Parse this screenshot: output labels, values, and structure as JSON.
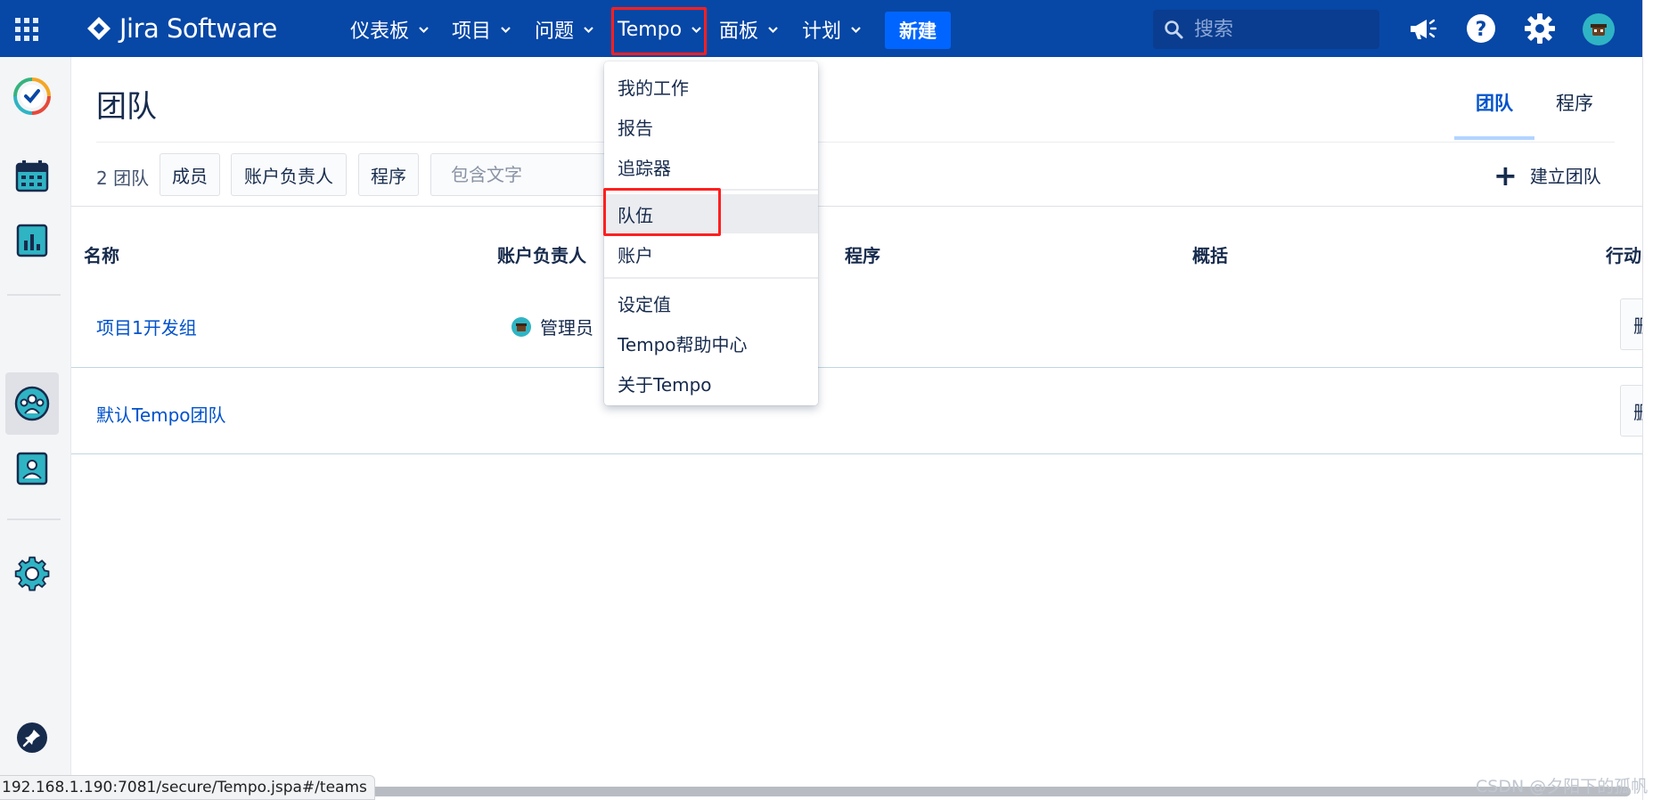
{
  "topnav": {
    "product": "Jira Software",
    "items": [
      {
        "label": "仪表板"
      },
      {
        "label": "项目"
      },
      {
        "label": "问题"
      },
      {
        "label": "Tempo"
      },
      {
        "label": "面板"
      },
      {
        "label": "计划"
      }
    ],
    "create_label": "新建",
    "search_placeholder": "搜索",
    "icons": [
      "apps-grid-icon",
      "megaphone-icon",
      "help-icon",
      "gear-icon",
      "avatar"
    ],
    "brand_color": "#0747a6",
    "create_color": "#0065ff",
    "highlight_color": "#ff1f1f"
  },
  "sidebar": {
    "icons": [
      "tempo-logo-icon",
      "calendar-icon",
      "reports-icon",
      "teams-icon",
      "user-icon",
      "settings-icon",
      "pin-icon"
    ],
    "active": "teams-icon"
  },
  "page": {
    "title": "团队",
    "tabs": [
      {
        "label": "团队",
        "active": true
      },
      {
        "label": "程序",
        "active": false
      }
    ]
  },
  "filters": {
    "count": "2 团队",
    "buttons": [
      "成员",
      "账户负责人",
      "程序"
    ],
    "text_placeholder": "包含文字",
    "create_team_label": "建立团队"
  },
  "table": {
    "columns": [
      "名称",
      "账户负责人",
      "程序",
      "概括",
      "行动"
    ],
    "rows": [
      {
        "name": "项目1开发组",
        "lead": "管理员",
        "action": "删"
      },
      {
        "name": "默认Tempo团队",
        "lead": "",
        "action": "删"
      }
    ]
  },
  "tempo_menu": {
    "sections": [
      [
        "我的工作",
        "报告",
        "追踪器"
      ],
      [
        "队伍",
        "账户"
      ],
      [
        "设定值",
        "Tempo帮助中心",
        "关于Tempo"
      ]
    ],
    "hovered": "队伍"
  },
  "status_bar": {
    "url": "192.168.1.190:7081/secure/Tempo.jspa#/teams"
  },
  "watermark": "CSDN @夕阳下的孤帆"
}
